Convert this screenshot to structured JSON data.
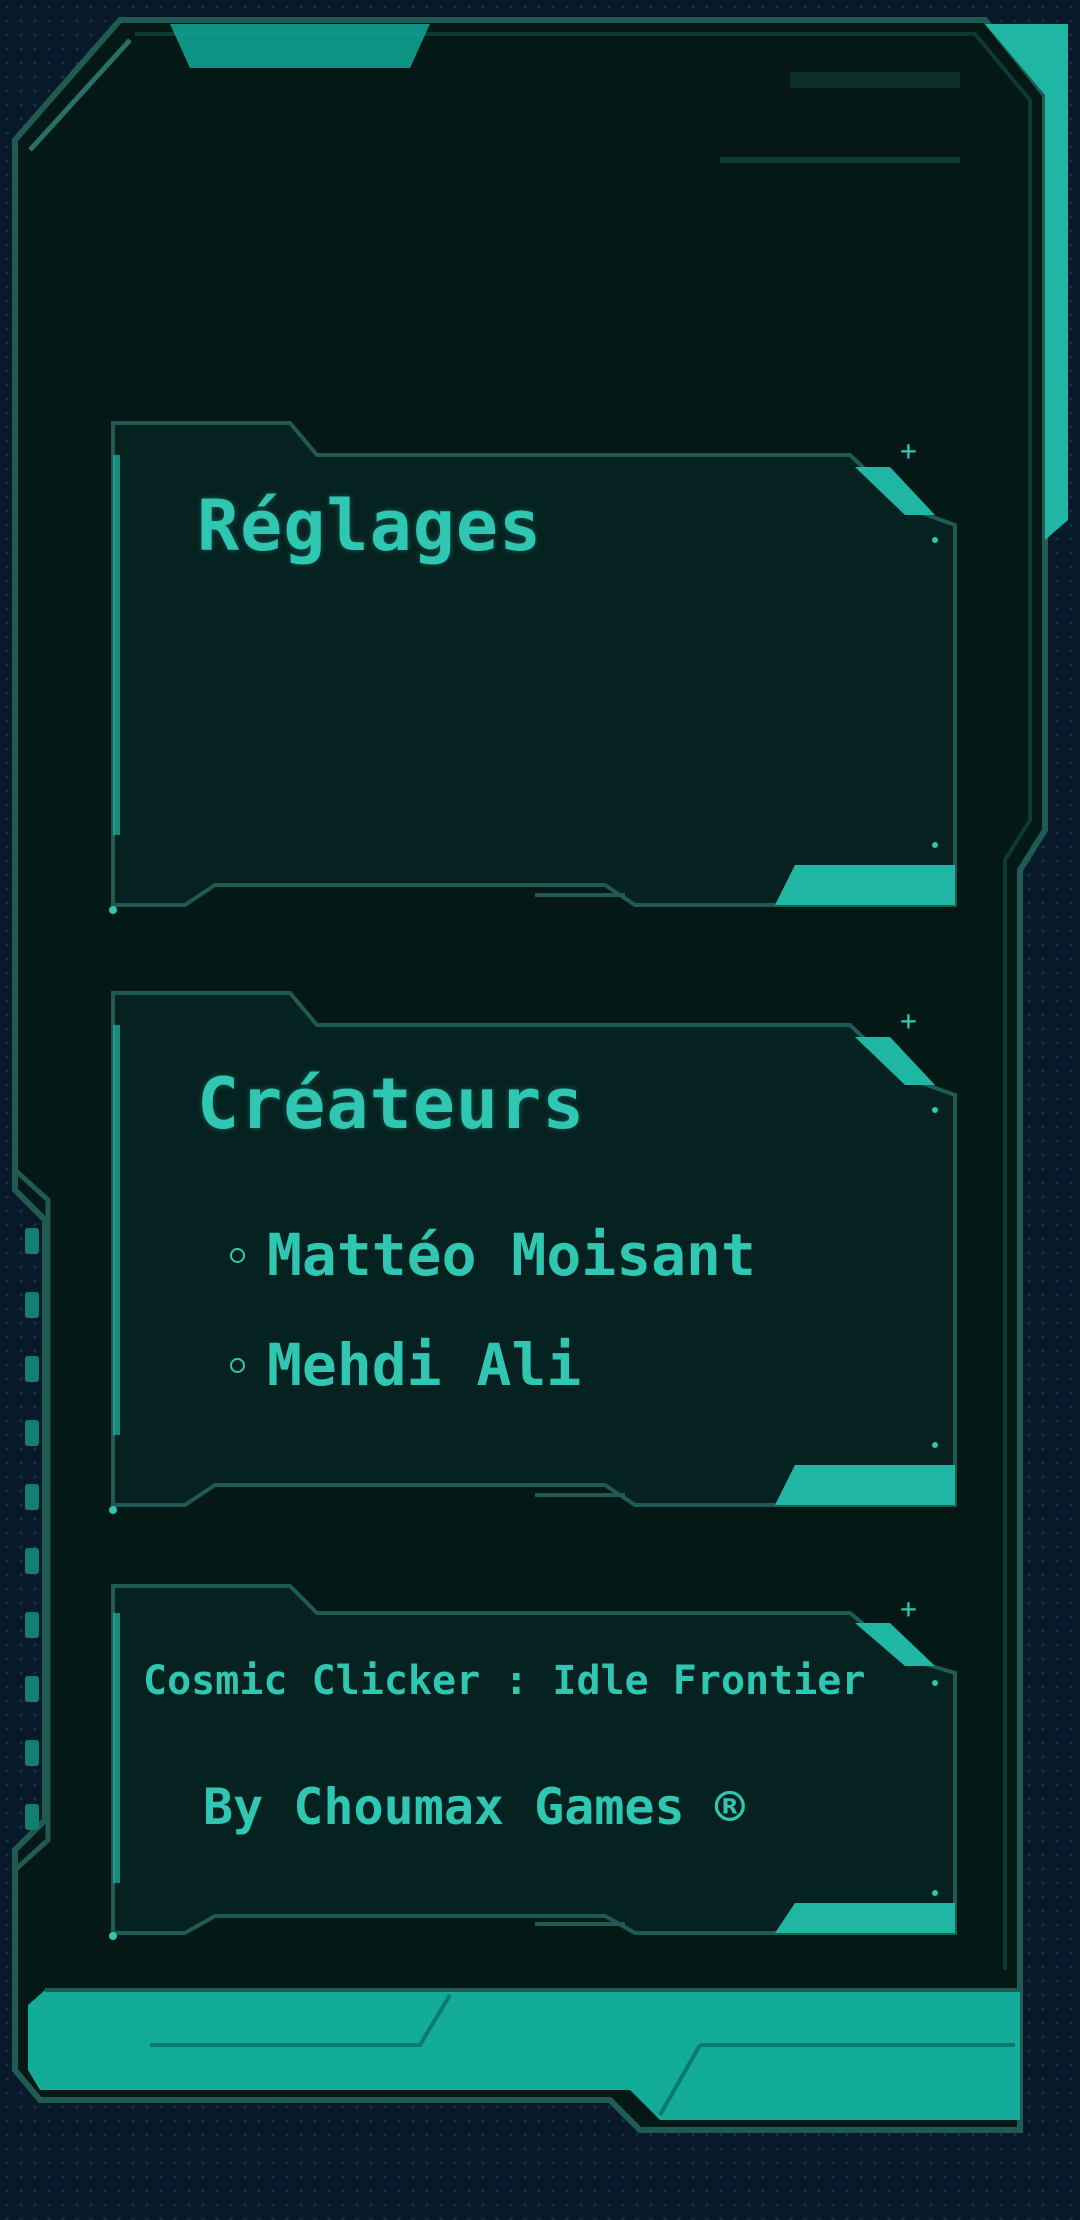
{
  "settings": {
    "title": "Réglages"
  },
  "credits": {
    "title": "Créateurs",
    "creators": [
      {
        "name": "Mattéo Moisant"
      },
      {
        "name": "Mehdi Ali"
      }
    ]
  },
  "footer": {
    "game_title": "Cosmic Clicker : Idle Frontier",
    "studio": "By Choumax Games ®"
  },
  "colors": {
    "background": "#081a2a",
    "frame_fill": "#041816",
    "frame_border": "#1f5a53",
    "accent": "#2fc7b2",
    "accent_dark": "#0fa896"
  }
}
